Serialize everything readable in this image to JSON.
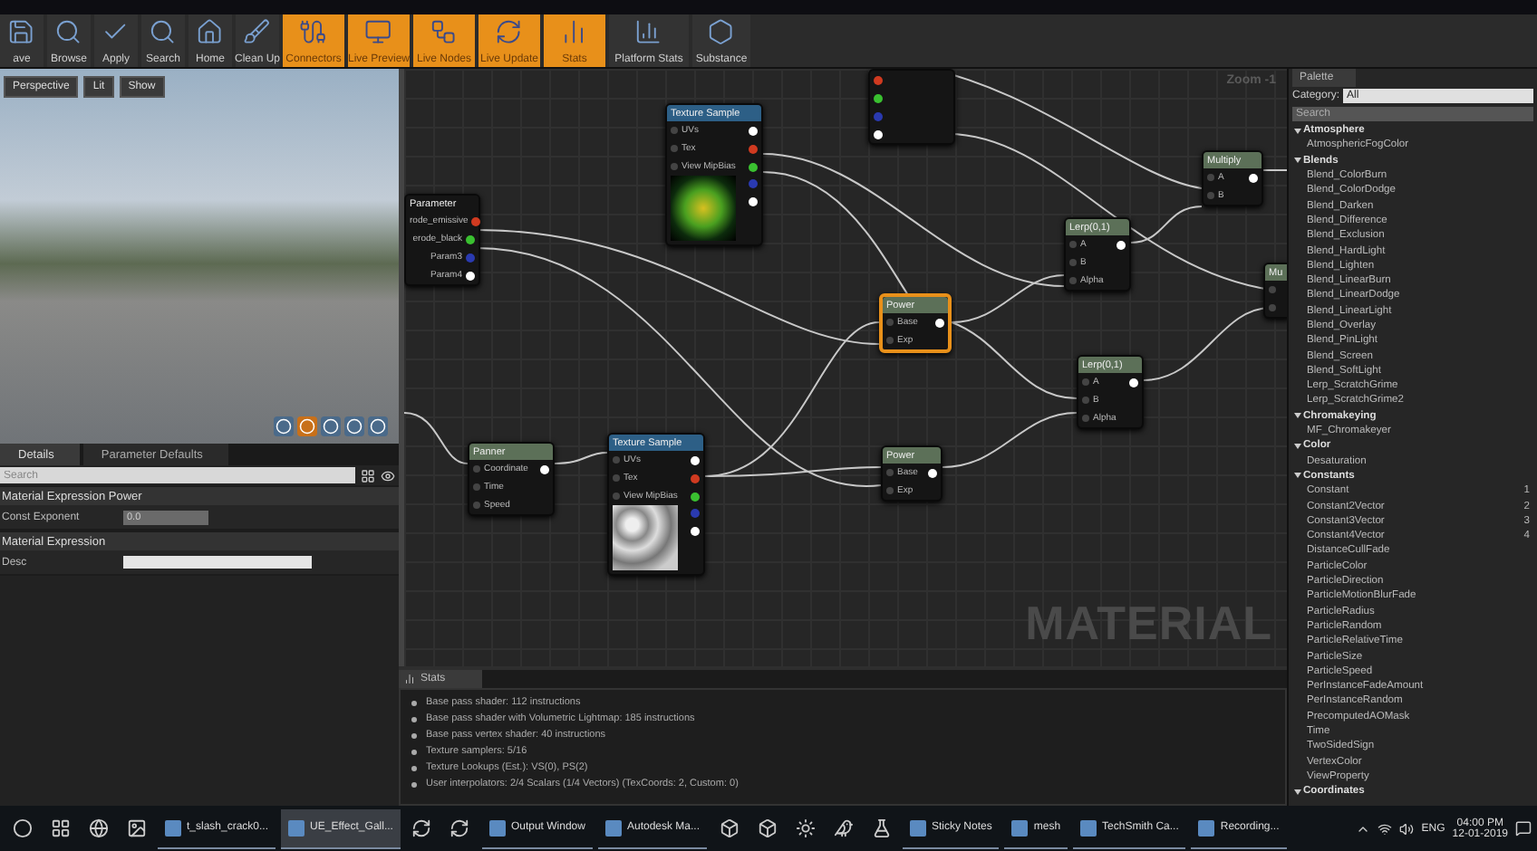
{
  "toolbar": [
    {
      "label": "ave",
      "kind": "save",
      "on": false
    },
    {
      "label": "Browse",
      "kind": "browse",
      "on": false
    },
    {
      "label": "Apply",
      "kind": "apply",
      "on": false
    },
    {
      "label": "Search",
      "kind": "search",
      "on": false
    },
    {
      "label": "Home",
      "kind": "home",
      "on": false
    },
    {
      "label": "Clean Up",
      "kind": "clean",
      "on": false
    },
    {
      "label": "Connectors",
      "kind": "connectors",
      "on": true
    },
    {
      "label": "Live Preview",
      "kind": "preview",
      "on": true
    },
    {
      "label": "Live Nodes",
      "kind": "nodes",
      "on": true
    },
    {
      "label": "Live Update",
      "kind": "update",
      "on": true
    },
    {
      "label": "Stats",
      "kind": "stats",
      "on": true
    },
    {
      "label": "Platform Stats",
      "kind": "platform",
      "on": false
    },
    {
      "label": "Substance",
      "kind": "substance",
      "on": false
    }
  ],
  "viewport": {
    "buttons": [
      "Perspective",
      "Lit",
      "Show"
    ]
  },
  "details": {
    "tabs": [
      {
        "label": "Details",
        "selected": true
      },
      {
        "label": "Parameter Defaults",
        "selected": false
      }
    ],
    "search": {
      "placeholder": "Search"
    },
    "sections": [
      {
        "title": "Material Expression Power",
        "rows": [
          {
            "label": "Const Exponent",
            "kind": "number",
            "value": "0.0"
          }
        ]
      },
      {
        "title": "Material Expression",
        "rows": [
          {
            "label": "Desc",
            "kind": "text"
          }
        ]
      }
    ]
  },
  "graph": {
    "zoom": "Zoom -1",
    "watermark": "MATERIAL",
    "nodes": [
      {
        "title": "Parameter",
        "kind": "parameter",
        "selected": false,
        "rows": [
          {
            "label": "rode_emissive",
            "in": false,
            "color": "#d03a20"
          },
          {
            "label": "erode_black",
            "in": false,
            "color": "#3ac030"
          },
          {
            "label": "Param3",
            "in": false,
            "color": "#2a3ab0"
          },
          {
            "label": "Param4",
            "in": false,
            "color": "#ffffff"
          }
        ]
      },
      {
        "title": "Texture Sample",
        "kind": "texture",
        "selected": false,
        "rows": [
          {
            "label": "UVs",
            "in": true,
            "color": "#ffffff"
          },
          {
            "label": "Tex",
            "in": true,
            "color": "#d03a20"
          },
          {
            "label": "View MipBias",
            "in": true,
            "color": "#3ac030"
          },
          {
            "in": false,
            "color": "#2a3ab0"
          },
          {
            "in": false,
            "color": "#ffffff"
          }
        ]
      },
      {
        "kind": "fragment",
        "selected": false,
        "rows": [
          {
            "in": false,
            "color": "#d03a20"
          },
          {
            "in": false,
            "color": "#3ac030"
          },
          {
            "in": false,
            "color": "#2a3ab0"
          },
          {
            "in": false,
            "color": "#ffffff"
          }
        ]
      },
      {
        "title": "Lerp(0,1)",
        "kind": "math",
        "selected": false,
        "rows": [
          {
            "label": "A",
            "in": true,
            "color": "#ffffff"
          },
          {
            "label": "B",
            "in": true
          },
          {
            "label": "Alpha",
            "in": true
          }
        ]
      },
      {
        "title": "Multiply",
        "kind": "math",
        "selected": false,
        "rows": [
          {
            "label": "A",
            "in": true,
            "color": "#ffffff"
          },
          {
            "label": "B",
            "in": true
          }
        ]
      },
      {
        "title": "Mu",
        "kind": "math",
        "selected": false,
        "rows": [
          {
            "in": true
          },
          {
            "in": true
          }
        ]
      },
      {
        "title": "Power",
        "kind": "math",
        "selected": true,
        "rows": [
          {
            "label": "Base",
            "in": true,
            "color": "#ffffff"
          },
          {
            "label": "Exp",
            "in": true
          }
        ]
      },
      {
        "title": "Lerp(0,1)",
        "kind": "math",
        "selected": false,
        "rows": [
          {
            "label": "A",
            "in": true,
            "color": "#ffffff"
          },
          {
            "label": "B",
            "in": true
          },
          {
            "label": "Alpha",
            "in": true
          }
        ]
      },
      {
        "title": "Panner",
        "kind": "math",
        "selected": false,
        "rows": [
          {
            "label": "Coordinate",
            "in": true,
            "color": "#ffffff"
          },
          {
            "label": "Time",
            "in": true
          },
          {
            "label": "Speed",
            "in": true
          }
        ]
      },
      {
        "title": "Texture Sample",
        "kind": "texture",
        "selected": false,
        "rows": [
          {
            "label": "UVs",
            "in": true,
            "color": "#ffffff"
          },
          {
            "label": "Tex",
            "in": true,
            "color": "#d03a20"
          },
          {
            "label": "View MipBias",
            "in": true,
            "color": "#3ac030"
          },
          {
            "in": false,
            "color": "#2a3ab0"
          },
          {
            "in": false,
            "color": "#ffffff"
          }
        ]
      },
      {
        "title": "Power",
        "kind": "math",
        "selected": false,
        "rows": [
          {
            "label": "Base",
            "in": true,
            "color": "#ffffff"
          },
          {
            "label": "Exp",
            "in": true
          }
        ]
      }
    ]
  },
  "stats": {
    "tab": "Stats",
    "lines": [
      "Base pass shader: 112 instructions",
      "Base pass shader with Volumetric Lightmap: 185 instructions",
      "Base pass vertex shader: 40 instructions",
      "Texture samplers: 5/16",
      "Texture Lookups (Est.): VS(0), PS(2)",
      "User interpolators: 2/4 Scalars (1/4 Vectors) (TexCoords: 2, Custom: 0)"
    ]
  },
  "palette": {
    "tab": "Palette",
    "category_label": "Category:",
    "category": "All",
    "search": {
      "placeholder": "Search"
    },
    "tree": [
      {
        "label": "Atmosphere",
        "expanded": true,
        "children": [
          {
            "label": "AtmosphericFogColor"
          }
        ]
      },
      {
        "label": "Blends",
        "expanded": true,
        "children": [
          {
            "label": "Blend_ColorBurn"
          },
          {
            "label": "Blend_ColorDodge"
          },
          {
            "label": "Blend_Darken"
          },
          {
            "label": "Blend_Difference"
          },
          {
            "label": "Blend_Exclusion"
          },
          {
            "label": "Blend_HardLight"
          },
          {
            "label": "Blend_Lighten"
          },
          {
            "label": "Blend_LinearBurn"
          },
          {
            "label": "Blend_LinearDodge"
          },
          {
            "label": "Blend_LinearLight"
          },
          {
            "label": "Blend_Overlay"
          },
          {
            "label": "Blend_PinLight"
          },
          {
            "label": "Blend_Screen"
          },
          {
            "label": "Blend_SoftLight"
          },
          {
            "label": "Lerp_ScratchGrime"
          },
          {
            "label": "Lerp_ScratchGrime2"
          }
        ]
      },
      {
        "label": "Chromakeying",
        "expanded": true,
        "children": [
          {
            "label": "MF_Chromakeyer"
          }
        ]
      },
      {
        "label": "Color",
        "expanded": true,
        "children": [
          {
            "label": "Desaturation"
          }
        ]
      },
      {
        "label": "Constants",
        "expanded": true,
        "children": [
          {
            "label": "Constant",
            "hotkey": "1"
          },
          {
            "label": "Constant2Vector",
            "hotkey": "2"
          },
          {
            "label": "Constant3Vector",
            "hotkey": "3"
          },
          {
            "label": "Constant4Vector",
            "hotkey": "4"
          },
          {
            "label": "DistanceCullFade"
          },
          {
            "label": "ParticleColor"
          },
          {
            "label": "ParticleDirection"
          },
          {
            "label": "ParticleMotionBlurFade"
          },
          {
            "label": "ParticleRadius"
          },
          {
            "label": "ParticleRandom"
          },
          {
            "label": "ParticleRelativeTime"
          },
          {
            "label": "ParticleSize"
          },
          {
            "label": "ParticleSpeed"
          },
          {
            "label": "PerInstanceFadeAmount"
          },
          {
            "label": "PerInstanceRandom"
          },
          {
            "label": "PrecomputedAOMask"
          },
          {
            "label": "Time"
          },
          {
            "label": "TwoSidedSign"
          },
          {
            "label": "VertexColor"
          },
          {
            "label": "ViewProperty"
          }
        ]
      },
      {
        "label": "Coordinates",
        "expanded": true
      }
    ]
  },
  "taskbar": {
    "items": [
      {
        "kind": "icon"
      },
      {
        "kind": "icon"
      },
      {
        "kind": "icon"
      },
      {
        "kind": "icon"
      },
      {
        "kind": "app",
        "label": "t_slash_crack0...",
        "active": false
      },
      {
        "kind": "app",
        "label": "UE_Effect_Gall...",
        "active": true
      },
      {
        "kind": "icon"
      },
      {
        "kind": "icon"
      },
      {
        "kind": "app",
        "label": "Output Window",
        "active": false
      },
      {
        "kind": "app",
        "label": "Autodesk Ma...",
        "active": false
      },
      {
        "kind": "icon"
      },
      {
        "kind": "icon"
      },
      {
        "kind": "icon"
      },
      {
        "kind": "icon"
      },
      {
        "kind": "icon"
      },
      {
        "kind": "app",
        "label": "Sticky Notes",
        "active": false
      },
      {
        "kind": "app",
        "label": "mesh",
        "active": false
      },
      {
        "kind": "app",
        "label": "TechSmith Ca...",
        "active": false
      },
      {
        "kind": "app",
        "label": "Recording...",
        "active": false
      }
    ],
    "lang": "ENG",
    "time": "04:00 PM",
    "date": "12-01-2019"
  }
}
